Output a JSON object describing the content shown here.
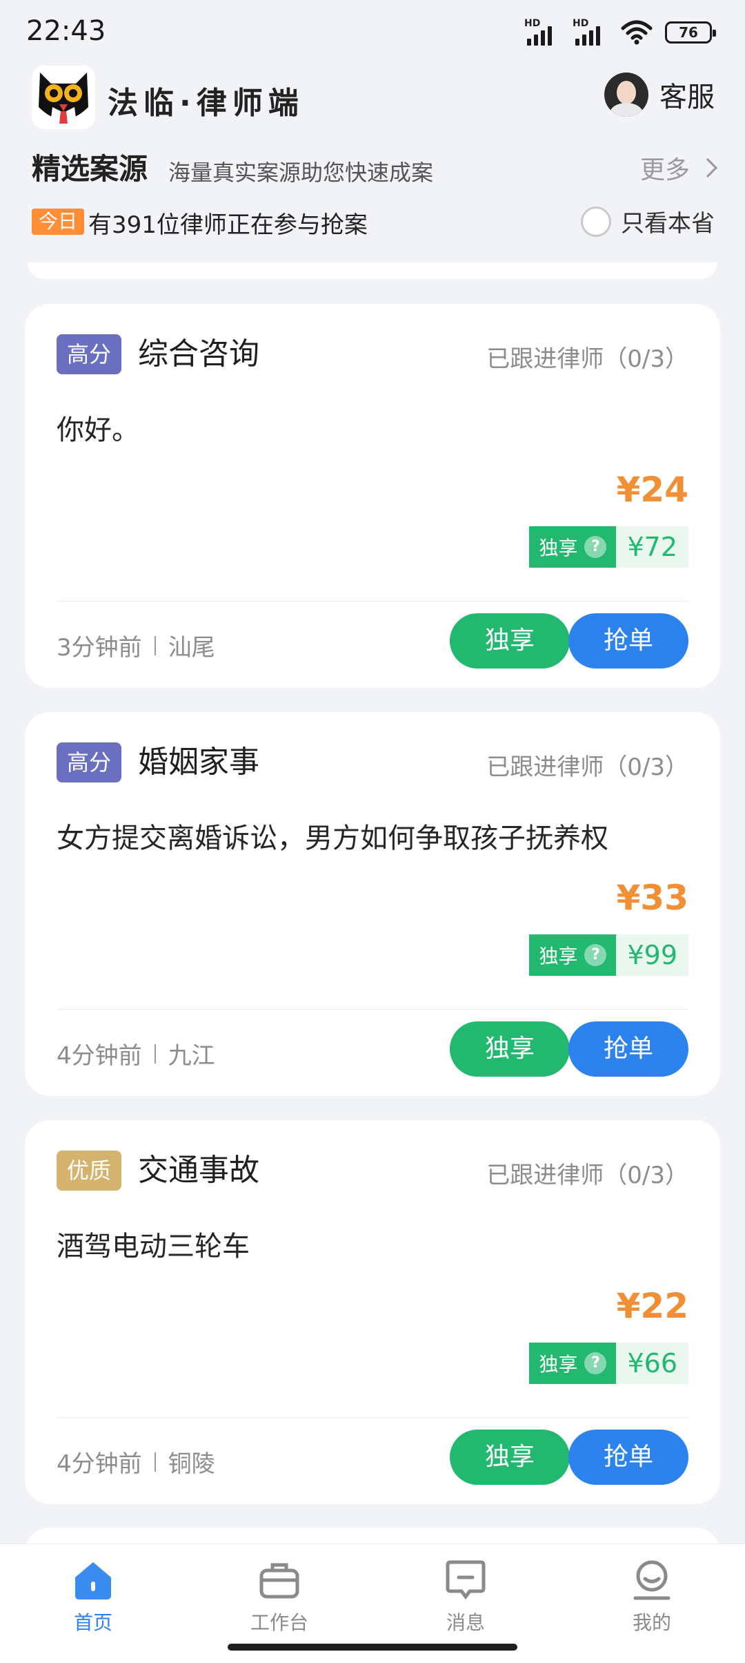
{
  "status_bar": {
    "time": "22:43",
    "sim1": "HD",
    "sim2": "HD",
    "battery": "76"
  },
  "header": {
    "app_title": "法临·律师端",
    "service_label": "客服"
  },
  "section": {
    "title": "精选案源",
    "subtitle": "海量真实案源助您快速成案",
    "more_label": "更多"
  },
  "today": {
    "badge": "今日",
    "text": "有391位律师正在参与抢案",
    "only_province": "只看本省"
  },
  "cards": [
    {
      "tag": "高分",
      "tag_style": "high",
      "case_type": "综合咨询",
      "follow": "已跟进律师（0/3）",
      "description": "你好。",
      "price": "¥24",
      "exclusive_label": "独享",
      "exclusive_price": "¥72",
      "time": "3分钟前",
      "location": "汕尾",
      "btn_exclusive": "独享",
      "btn_grab": "抢单"
    },
    {
      "tag": "高分",
      "tag_style": "high",
      "case_type": "婚姻家事",
      "follow": "已跟进律师（0/3）",
      "description": "女方提交离婚诉讼，男方如何争取孩子抚养权",
      "price": "¥33",
      "exclusive_label": "独享",
      "exclusive_price": "¥99",
      "time": "4分钟前",
      "location": "九江",
      "btn_exclusive": "独享",
      "btn_grab": "抢单"
    },
    {
      "tag": "优质",
      "tag_style": "good",
      "case_type": "交通事故",
      "follow": "已跟进律师（0/3）",
      "description": "酒驾电动三轮车",
      "price": "¥22",
      "exclusive_label": "独享",
      "exclusive_price": "¥66",
      "time": "4分钟前",
      "location": "铜陵",
      "btn_exclusive": "独享",
      "btn_grab": "抢单"
    }
  ],
  "nav": [
    {
      "label": "首页",
      "icon": "home-icon",
      "active": true
    },
    {
      "label": "工作台",
      "icon": "briefcase-icon",
      "active": false
    },
    {
      "label": "消息",
      "icon": "message-icon",
      "active": false
    },
    {
      "label": "我的",
      "icon": "profile-icon",
      "active": false
    }
  ],
  "colors": {
    "accent_blue": "#2c83ee",
    "green": "#22b86f",
    "orange": "#f08f36",
    "tag_high": "#6a6fc0",
    "tag_good": "#d3b36e"
  }
}
